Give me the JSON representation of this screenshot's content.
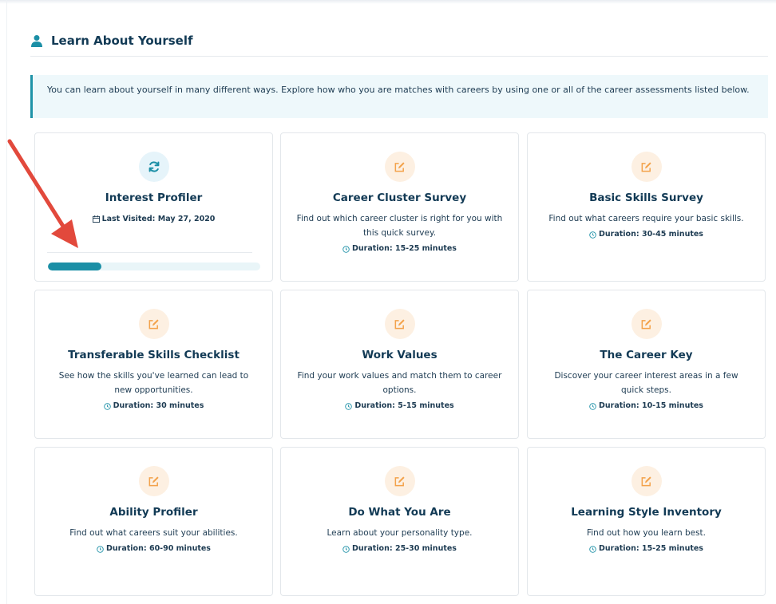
{
  "section": {
    "title": "Learn About Yourself",
    "intro": "You can learn about yourself in many different ways. Explore how who you are matches with careers by using one or all of the career assessments listed below."
  },
  "colors": {
    "accent": "#1b8fa6",
    "heading": "#123a55",
    "icon_orange": "#f3a24b",
    "icon_blue": "#1b8fa6",
    "arrow": "#e2493c"
  },
  "assessments": [
    {
      "title": "Interest Profiler",
      "icon": "refresh-icon",
      "last_visited": "Last Visited: May 27, 2020",
      "progress": 0.25
    },
    {
      "title": "Career Cluster Survey",
      "icon": "edit-icon",
      "desc": "Find out which career cluster is right for you with this quick survey.",
      "duration": "Duration: 15-25 minutes"
    },
    {
      "title": "Basic Skills Survey",
      "icon": "edit-icon",
      "desc": "Find out what careers require your basic skills.",
      "duration": "Duration: 30-45 minutes"
    },
    {
      "title": "Transferable Skills Checklist",
      "icon": "edit-icon",
      "desc": "See how the skills you've learned can lead to new opportunities.",
      "duration": "Duration: 30 minutes"
    },
    {
      "title": "Work Values",
      "icon": "edit-icon",
      "desc": "Find your work values and match them to career options.",
      "duration": "Duration: 5-15 minutes"
    },
    {
      "title": "The Career Key",
      "icon": "edit-icon",
      "desc": "Discover your career interest areas in a few quick steps.",
      "duration": "Duration: 10-15 minutes"
    },
    {
      "title": "Ability Profiler",
      "icon": "edit-icon",
      "desc": "Find out what careers suit your abilities.",
      "duration": "Duration: 60-90 minutes"
    },
    {
      "title": "Do What You Are",
      "icon": "edit-icon",
      "desc": "Learn about your personality type.",
      "duration": "Duration: 25-30 minutes"
    },
    {
      "title": "Learning Style Inventory",
      "icon": "edit-icon",
      "desc": "Find out how you learn best.",
      "duration": "Duration: 15-25 minutes"
    }
  ]
}
